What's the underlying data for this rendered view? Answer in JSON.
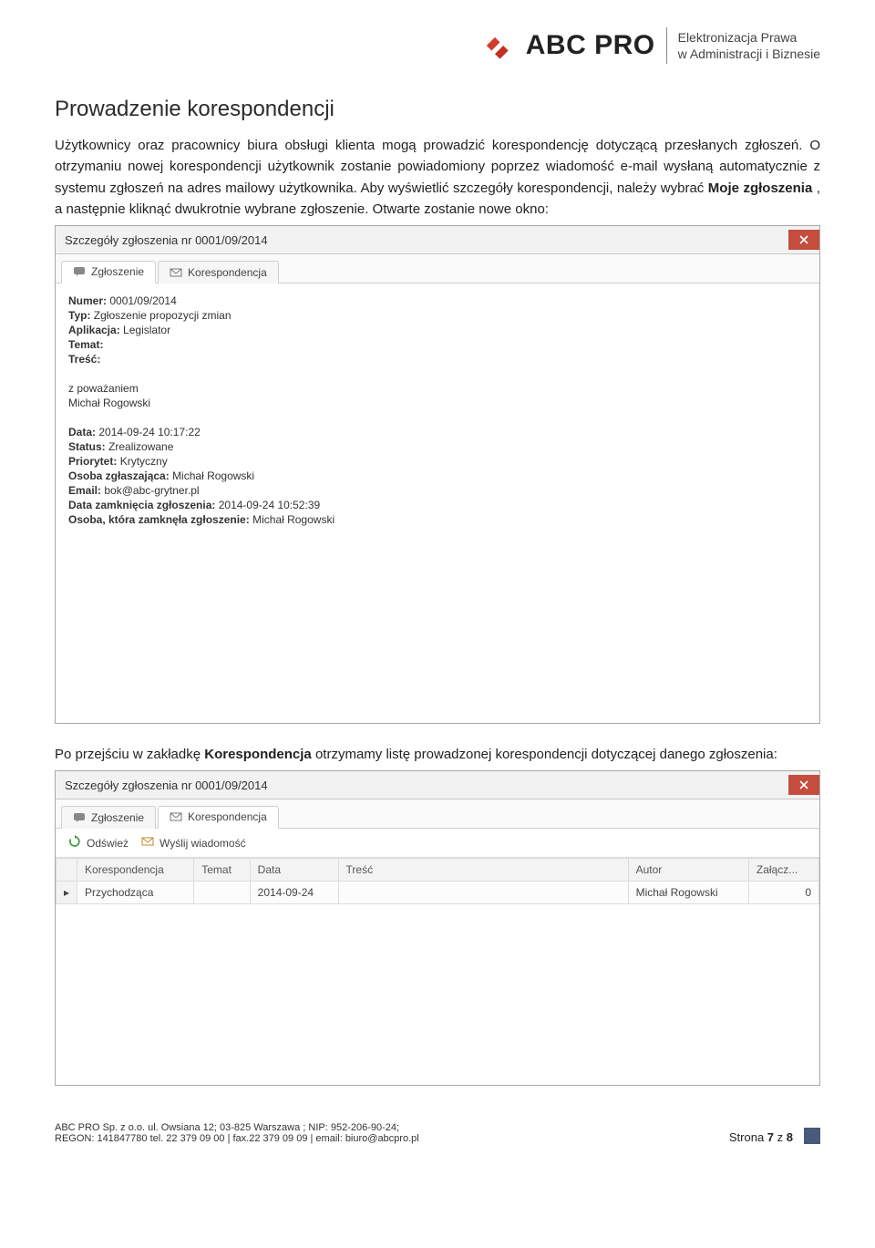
{
  "logo": {
    "brand": "ABC PRO",
    "tagline_line1": "Elektronizacja Prawa",
    "tagline_line2": "w Administracji i Biznesie"
  },
  "doc": {
    "section_title": "Prowadzenie korespondencji",
    "para1_a": "Użytkownicy oraz pracownicy biura obsługi klienta mogą prowadzić korespondencję dotyczącą przesłanych zgłoszeń. O otrzymaniu nowej korespondencji użytkownik zostanie powiadomiony poprzez wiadomość e-mail wysłaną automatycznie z systemu zgłoszeń na adres mailowy użytkownika. Aby wyświetlić szczegóły korespondencji, należy wybrać ",
    "para1_bold": "Moje zgłoszenia",
    "para1_b": ", a następnie kliknąć dwukrotnie wybrane zgłoszenie. Otwarte zostanie nowe okno:",
    "para2_a": "Po przejściu w zakładkę ",
    "para2_bold": "Korespondencja",
    "para2_b": " otrzymamy listę prowadzonej korespondencji dotyczącej danego zgłoszenia:"
  },
  "win1": {
    "title": "Szczegóły zgłoszenia nr 0001/09/2014",
    "tabs": {
      "t1": "Zgłoszenie",
      "t2": "Korespondencja"
    },
    "labels": {
      "numer": "Numer:",
      "typ": "Typ:",
      "aplikacja": "Aplikacja:",
      "temat": "Temat:",
      "tresc": "Treść:",
      "sign1": "z poważaniem",
      "sign2": "Michał Rogowski",
      "data": "Data:",
      "status": "Status:",
      "priorytet": "Priorytet:",
      "osoba_zgl": "Osoba zgłaszająca:",
      "email": "Email:",
      "data_zamk": "Data zamknięcia zgłoszenia:",
      "osoba_zamk": "Osoba, która zamknęła zgłoszenie:"
    },
    "values": {
      "numer": "0001/09/2014",
      "typ": "Zgłoszenie propozycji zmian",
      "aplikacja": "Legislator",
      "temat": "",
      "tresc": "",
      "data": "2014-09-24 10:17:22",
      "status": "Zrealizowane",
      "priorytet": "Krytyczny",
      "osoba_zgl": "Michał Rogowski",
      "email": "bok@abc-grytner.pl",
      "data_zamk": "2014-09-24 10:52:39",
      "osoba_zamk": "Michał Rogowski"
    }
  },
  "win2": {
    "title": "Szczegóły zgłoszenia nr 0001/09/2014",
    "tabs": {
      "t1": "Zgłoszenie",
      "t2": "Korespondencja"
    },
    "toolbar": {
      "refresh": "Odśwież",
      "send": "Wyślij wiadomość"
    },
    "grid_headers": {
      "kor": "Korespondencja",
      "temat": "Temat",
      "data": "Data",
      "tresc": "Treść",
      "autor": "Autor",
      "zalacz": "Załącz..."
    },
    "row": {
      "kor": "Przychodząca",
      "temat": "",
      "data": "2014-09-24",
      "tresc": "",
      "autor": "Michał Rogowski",
      "zalacz": "0"
    }
  },
  "footer": {
    "line1": "ABC PRO Sp. z o.o. ul. Owsiana 12;  03-825 Warszawa ; NIP: 952-206-90-24;",
    "line2": "REGON: 141847780 tel. 22 379 09 00 | fax.22 379 09 09 | email: biuro@abcpro.pl",
    "page_a": "Strona ",
    "page_n": "7",
    "page_mid": " z ",
    "page_total": "8"
  }
}
